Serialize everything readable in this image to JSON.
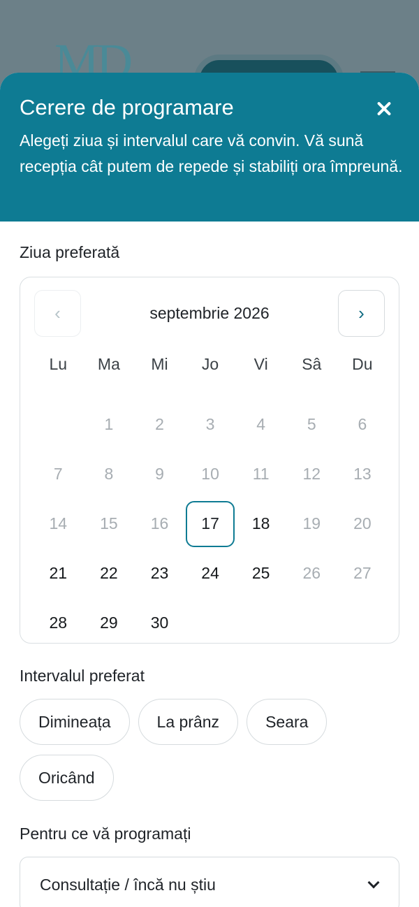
{
  "backdrop": {
    "logo_text": "MD"
  },
  "modal": {
    "title": "Cerere de programare",
    "description": "Alegeți ziua și intervalul care vă convin. Vă sună recepția cât putem de repede și stabiliți ora împreună.",
    "close_icon": "close-icon"
  },
  "day_section": {
    "label": "Ziua preferată",
    "month_label": "septembrie 2026",
    "prev_label": "‹",
    "next_label": "›",
    "weekdays": [
      "Lu",
      "Ma",
      "Mi",
      "Jo",
      "Vi",
      "Sâ",
      "Du"
    ],
    "leading_blanks": 1,
    "days": [
      {
        "n": "1",
        "state": "muted"
      },
      {
        "n": "2",
        "state": "muted"
      },
      {
        "n": "3",
        "state": "muted"
      },
      {
        "n": "4",
        "state": "muted"
      },
      {
        "n": "5",
        "state": "muted"
      },
      {
        "n": "6",
        "state": "muted"
      },
      {
        "n": "7",
        "state": "muted"
      },
      {
        "n": "8",
        "state": "muted"
      },
      {
        "n": "9",
        "state": "muted"
      },
      {
        "n": "10",
        "state": "muted"
      },
      {
        "n": "11",
        "state": "muted"
      },
      {
        "n": "12",
        "state": "muted"
      },
      {
        "n": "13",
        "state": "muted"
      },
      {
        "n": "14",
        "state": "muted"
      },
      {
        "n": "15",
        "state": "muted"
      },
      {
        "n": "16",
        "state": "muted"
      },
      {
        "n": "17",
        "state": "selected"
      },
      {
        "n": "18",
        "state": "avail"
      },
      {
        "n": "19",
        "state": "muted"
      },
      {
        "n": "20",
        "state": "muted"
      },
      {
        "n": "21",
        "state": "avail"
      },
      {
        "n": "22",
        "state": "avail"
      },
      {
        "n": "23",
        "state": "avail"
      },
      {
        "n": "24",
        "state": "avail"
      },
      {
        "n": "25",
        "state": "avail"
      },
      {
        "n": "26",
        "state": "muted"
      },
      {
        "n": "27",
        "state": "muted"
      },
      {
        "n": "28",
        "state": "avail"
      },
      {
        "n": "29",
        "state": "avail"
      },
      {
        "n": "30",
        "state": "avail"
      }
    ]
  },
  "interval_section": {
    "label": "Intervalul preferat",
    "options": [
      "Dimineața",
      "La prânz",
      "Seara",
      "Oricând"
    ]
  },
  "reason_section": {
    "label": "Pentru ce vă programați",
    "selected_value": "Consultație / încă nu știu"
  },
  "colors": {
    "accent": "#0e7b93",
    "muted_text": "#a7adb2",
    "backdrop": "#6c8088"
  }
}
